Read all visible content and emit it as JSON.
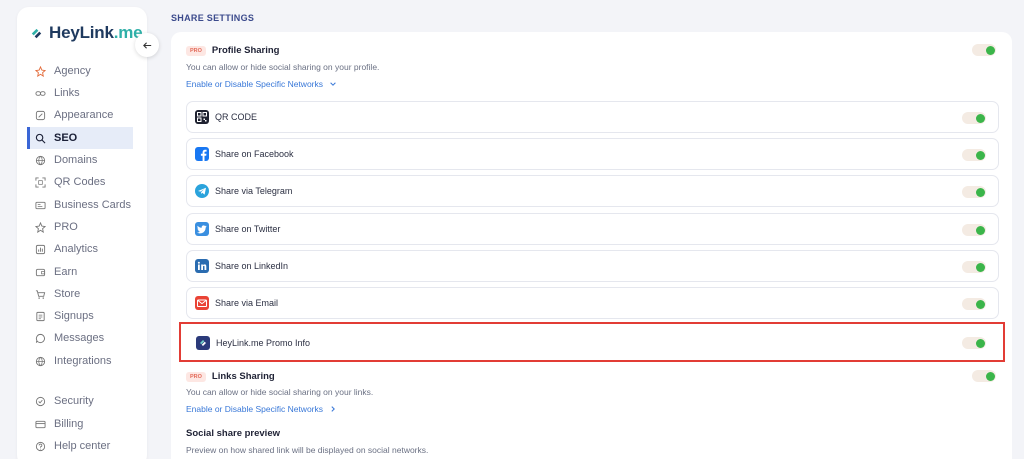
{
  "brand": {
    "name_main": "HeyLink",
    "name_dot": ".me"
  },
  "sidebar": {
    "items": [
      {
        "label": "Agency",
        "icon": "agency-icon"
      },
      {
        "label": "Links",
        "icon": "links-icon"
      },
      {
        "label": "Appearance",
        "icon": "appearance-icon"
      },
      {
        "label": "SEO",
        "icon": "seo-icon",
        "active": true
      },
      {
        "label": "Domains",
        "icon": "domains-icon"
      },
      {
        "label": "QR Codes",
        "icon": "qr-icon"
      },
      {
        "label": "Business Cards",
        "icon": "business-card-icon"
      },
      {
        "label": "PRO",
        "icon": "pro-icon"
      },
      {
        "label": "Analytics",
        "icon": "analytics-icon"
      },
      {
        "label": "Earn",
        "icon": "earn-icon"
      },
      {
        "label": "Store",
        "icon": "store-icon"
      },
      {
        "label": "Signups",
        "icon": "signups-icon"
      },
      {
        "label": "Messages",
        "icon": "messages-icon"
      },
      {
        "label": "Integrations",
        "icon": "integrations-icon"
      }
    ],
    "bottom_items": [
      {
        "label": "Security",
        "icon": "security-icon"
      },
      {
        "label": "Billing",
        "icon": "billing-icon"
      },
      {
        "label": "Help center",
        "icon": "help-icon"
      }
    ]
  },
  "main": {
    "section_title": "SHARE SETTINGS",
    "pro_badge": "PRO",
    "profile_sharing": {
      "title": "Profile Sharing",
      "description": "You can allow or hide social sharing on your profile.",
      "link": "Enable or Disable Specific Networks",
      "enabled": true
    },
    "networks": [
      {
        "label": "QR CODE",
        "icon": "qr-code-icon",
        "enabled": true
      },
      {
        "label": "Share on Facebook",
        "icon": "facebook-icon",
        "enabled": true
      },
      {
        "label": "Share via Telegram",
        "icon": "telegram-icon",
        "enabled": true
      },
      {
        "label": "Share on Twitter",
        "icon": "twitter-icon",
        "enabled": true
      },
      {
        "label": "Share on LinkedIn",
        "icon": "linkedin-icon",
        "enabled": true
      },
      {
        "label": "Share via Email",
        "icon": "email-icon",
        "enabled": true
      },
      {
        "label": "HeyLink.me Promo Info",
        "icon": "heylink-icon",
        "enabled": true,
        "highlighted": true
      }
    ],
    "links_sharing": {
      "title": "Links Sharing",
      "description": "You can allow or hide social sharing on your links.",
      "link": "Enable or Disable Specific Networks",
      "enabled": true
    },
    "social_preview": {
      "title": "Social share preview",
      "description": "Preview on how shared link will be displayed on social networks."
    }
  },
  "colors": {
    "accent": "#3a66d6",
    "toggle_on": "#3bb54a",
    "link": "#3978d8",
    "highlight_border": "#e23c35"
  }
}
